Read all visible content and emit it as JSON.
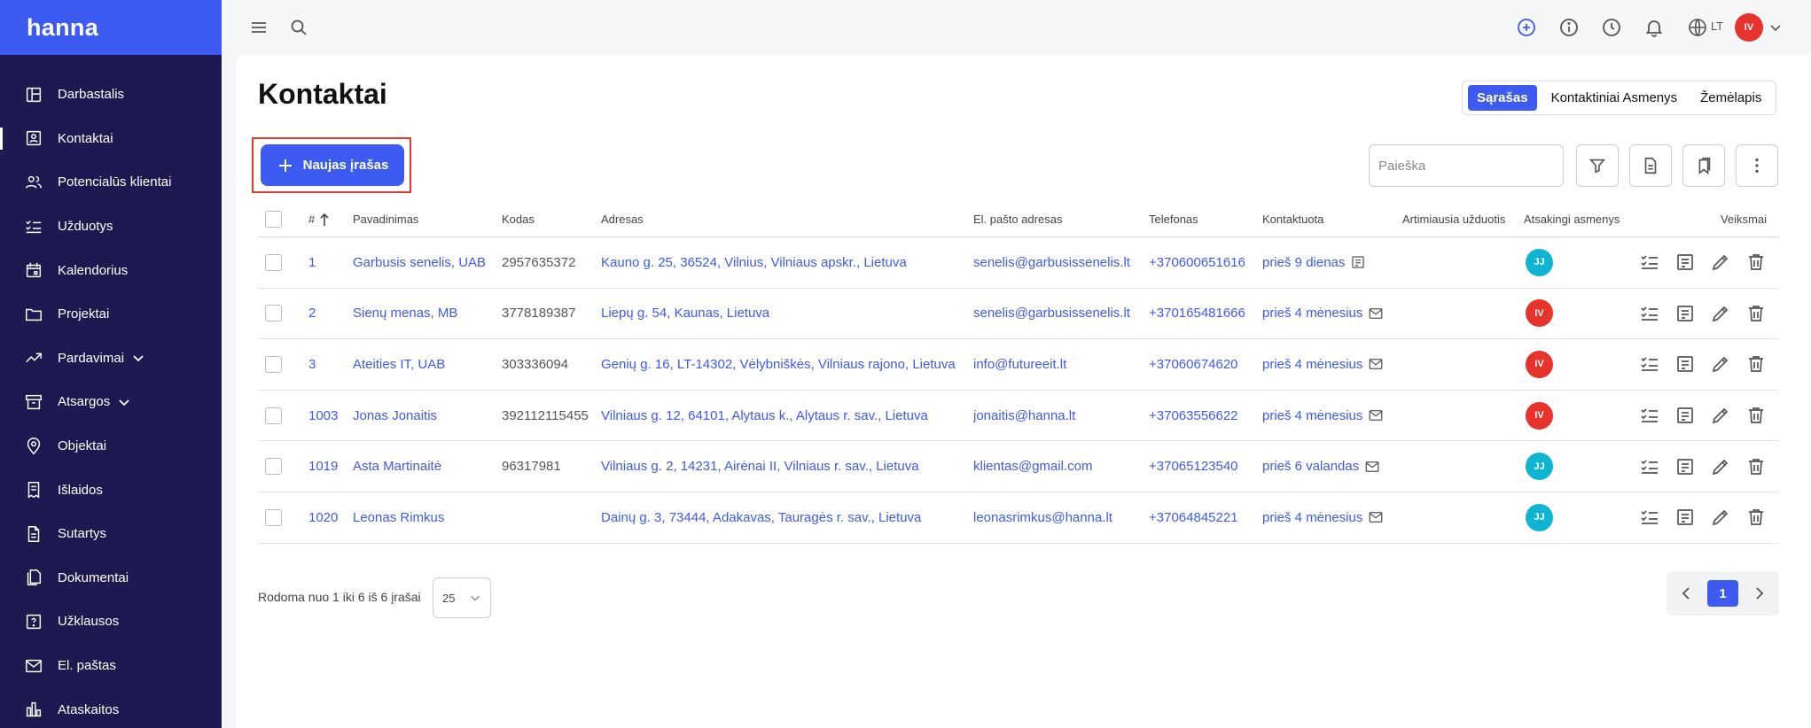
{
  "app": {
    "logo": "hanna",
    "language": "LT",
    "user_initials": "IV"
  },
  "colors": {
    "brand": "#3d5af1",
    "sidebar": "#1d1a52",
    "avatar_iv": "#e8322c",
    "avatar_jj": "#0fb4d0"
  },
  "sidebar": {
    "items": [
      {
        "label": "Darbastalis",
        "icon": "dashboard-icon"
      },
      {
        "label": "Kontaktai",
        "icon": "contact-card-icon",
        "active": true
      },
      {
        "label": "Potencialūs klientai",
        "icon": "users-icon"
      },
      {
        "label": "Užduotys",
        "icon": "tasks-icon"
      },
      {
        "label": "Kalendorius",
        "icon": "calendar-icon"
      },
      {
        "label": "Projektai",
        "icon": "folder-icon"
      },
      {
        "label": "Pardavimai",
        "icon": "trending-up-icon",
        "expandable": true
      },
      {
        "label": "Atsargos",
        "icon": "archive-icon",
        "expandable": true
      },
      {
        "label": "Objektai",
        "icon": "map-pin-icon"
      },
      {
        "label": "Išlaidos",
        "icon": "receipt-icon"
      },
      {
        "label": "Sutartys",
        "icon": "contract-icon"
      },
      {
        "label": "Dokumentai",
        "icon": "documents-icon"
      },
      {
        "label": "Užklausos",
        "icon": "question-icon"
      },
      {
        "label": "El. paštas",
        "icon": "mail-icon"
      },
      {
        "label": "Ataskaitos",
        "icon": "chart-icon"
      }
    ]
  },
  "page": {
    "title": "Kontaktai",
    "new_button": "Naujas įrašas",
    "search_placeholder": "Paieška"
  },
  "view_tabs": [
    {
      "label": "Sąrašas",
      "active": true
    },
    {
      "label": "Kontaktiniai Asmenys"
    },
    {
      "label": "Žemėlapis"
    }
  ],
  "table": {
    "headers": {
      "num": "#",
      "name": "Pavadinimas",
      "code": "Kodas",
      "address": "Adresas",
      "email": "El. pašto adresas",
      "phone": "Telefonas",
      "contacted": "Kontaktuota",
      "task": "Artimiausia užduotis",
      "responsible": "Atsakingi asmenys",
      "actions": "Veiksmai"
    },
    "rows": [
      {
        "num": "1",
        "name": "Garbusis senelis, UAB",
        "code": "2957635372",
        "address": "Kauno g. 25, 36524, Vilnius, Vilniaus apskr., Lietuva",
        "email": "senelis@garbusissenelis.lt",
        "phone": "+370600651616",
        "contacted": "prieš 9 dienas",
        "contact_icon": "note-icon",
        "responsible": "JJ"
      },
      {
        "num": "2",
        "name": "Sienų menas, MB",
        "code": "3778189387",
        "address": "Liepų g. 54, Kaunas, Lietuva",
        "email": "senelis@garbusissenelis.lt",
        "phone": "+370165481666",
        "contacted": "prieš 4 mėnesius",
        "contact_icon": "mail-icon",
        "responsible": "IV"
      },
      {
        "num": "3",
        "name": "Ateities IT, UAB",
        "code": "303336094",
        "address": "Genių g. 16, LT-14302, Vėlybniškės, Vilniaus rajono, Lietuva",
        "email": "info@futureeit.lt",
        "phone": "+37060674620",
        "contacted": "prieš 4 mėnesius",
        "contact_icon": "mail-icon",
        "responsible": "IV"
      },
      {
        "num": "1003",
        "name": "Jonas Jonaitis",
        "code": "392112115455",
        "address": "Vilniaus g. 12, 64101, Alytaus k., Alytaus r. sav., Lietuva",
        "email": "jonaitis@hanna.lt",
        "phone": "+37063556622",
        "contacted": "prieš 4 mėnesius",
        "contact_icon": "mail-icon",
        "responsible": "IV"
      },
      {
        "num": "1019",
        "name": "Asta Martinaitė",
        "code": "96317981",
        "address": "Vilniaus g. 2, 14231, Airėnai II, Vilniaus r. sav., Lietuva",
        "email": "klientas@gmail.com",
        "phone": "+37065123540",
        "contacted": "prieš 6 valandas",
        "contact_icon": "mail-icon",
        "responsible": "JJ"
      },
      {
        "num": "1020",
        "name": "Leonas Rimkus",
        "code": "",
        "address": "Dainų g. 3, 73444, Adakavas, Tauragės r. sav., Lietuva",
        "email": "leonasrimkus@hanna.lt",
        "phone": "+37064845221",
        "contacted": "prieš 4 mėnesius",
        "contact_icon": "mail-icon",
        "responsible": "JJ"
      }
    ]
  },
  "footer": {
    "showing": "Rodoma nuo 1 iki 6 iš 6 įrašai",
    "page_size": "25",
    "current_page": "1"
  }
}
